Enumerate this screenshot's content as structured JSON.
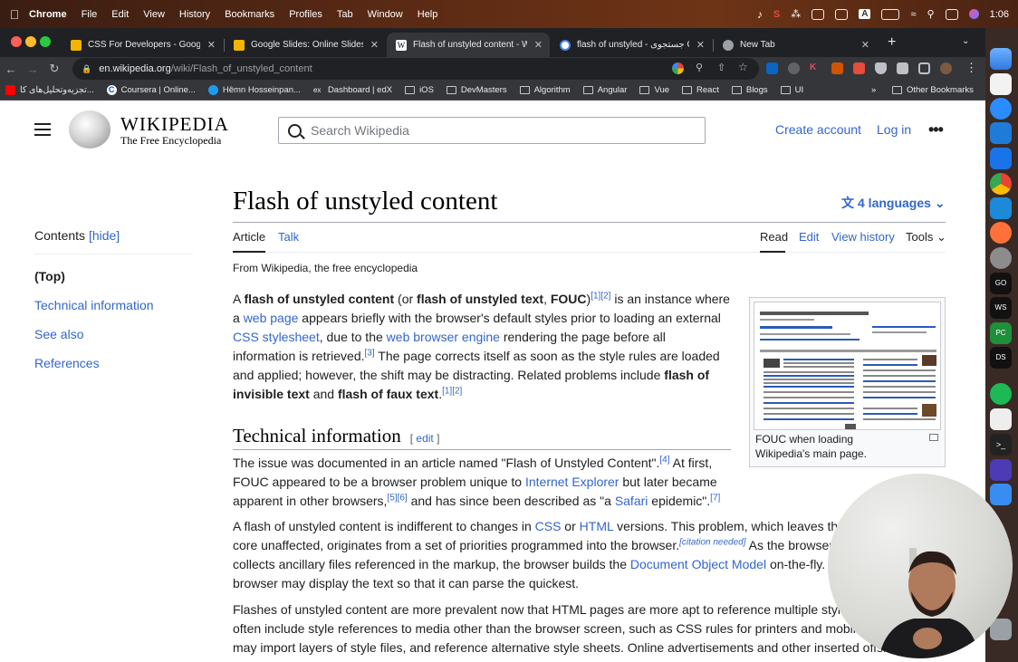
{
  "menubar": {
    "app": "Chrome",
    "items": [
      "File",
      "Edit",
      "View",
      "History",
      "Bookmarks",
      "Profiles",
      "Tab",
      "Window",
      "Help"
    ],
    "time": "1:06"
  },
  "browser": {
    "tabs": [
      {
        "title": "CSS For Developers - Google S",
        "favicon_color": "#f4b400"
      },
      {
        "title": "Google Slides: Online Slidesho",
        "favicon_color": "#f4b400"
      },
      {
        "title": "Flash of unstyled content - Wik",
        "favicon_color": "#ffffff"
      },
      {
        "title": "flash of unstyled - جستجوی Goo",
        "favicon_color": "#4285f4"
      },
      {
        "title": "New Tab",
        "favicon_color": "#9aa0a6"
      }
    ],
    "address": {
      "domain": "en.wikipedia.org",
      "path": "/wiki/Flash_of_unstyled_content"
    },
    "bookmarks": [
      {
        "label": "تجزیه‌وتحلیل‌های کا...",
        "icon": "youtube-icon"
      },
      {
        "label": "Coursera | Online...",
        "icon": "coursera-icon"
      },
      {
        "label": "Hêmn Hosseinpan...",
        "icon": "twitter-icon"
      },
      {
        "label": "Dashboard | edX",
        "icon": "edx-icon"
      },
      {
        "label": "iOS",
        "icon": "folder-icon"
      },
      {
        "label": "DevMasters",
        "icon": "folder-icon"
      },
      {
        "label": "Algorithm",
        "icon": "folder-icon"
      },
      {
        "label": "Angular",
        "icon": "folder-icon"
      },
      {
        "label": "Vue",
        "icon": "folder-icon"
      },
      {
        "label": "React",
        "icon": "folder-icon"
      },
      {
        "label": "Blogs",
        "icon": "folder-icon"
      },
      {
        "label": "UI",
        "icon": "folder-icon"
      }
    ],
    "bookmarks_more": "»",
    "other_bookmarks": "Other Bookmarks"
  },
  "wiki": {
    "wordmark": "WIKIPEDIA",
    "tagline": "The Free Encyclopedia",
    "search_placeholder": "Search Wikipedia",
    "create_account": "Create account",
    "log_in": "Log in",
    "more": "•••",
    "toc": {
      "title": "Contents",
      "hide": "[hide]",
      "items": [
        "(Top)",
        "Technical information",
        "See also",
        "References"
      ]
    },
    "title": "Flash of unstyled content",
    "languages": "4 languages",
    "tabs": {
      "article": "Article",
      "talk": "Talk",
      "read": "Read",
      "edit": "Edit",
      "view_history": "View history",
      "tools": "Tools"
    },
    "from": "From Wikipedia, the free encyclopedia",
    "section1": "Technical information",
    "edit_label": "edit",
    "thumb_caption": "FOUC when loading Wikipedia's main page."
  },
  "colors": {
    "link": "#3366cc",
    "text": "#202122",
    "border": "#a2a9b1"
  }
}
